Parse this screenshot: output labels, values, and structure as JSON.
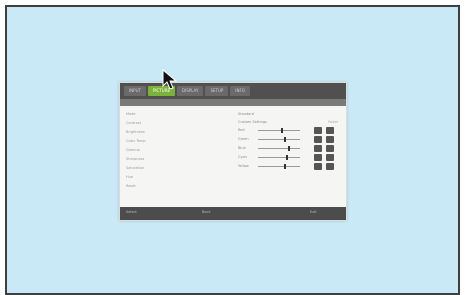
{
  "monitor": {
    "tabs": [
      "INPUT",
      "PICTURE",
      "DISPLAY",
      "SETUP",
      "INFO"
    ],
    "active_tab_index": 1,
    "left_list": [
      "Mode",
      "Contrast",
      "Brightness",
      "Color Temp",
      "Gamma",
      "Sharpness",
      "Saturation",
      "Hue",
      "Reset"
    ],
    "right_panel": {
      "line1": "Standard",
      "line2": "Custom Settings",
      "reset_label": "Reset",
      "rows": [
        {
          "label": "Red",
          "level": 0.55
        },
        {
          "label": "Green",
          "level": 0.62
        },
        {
          "label": "Blue",
          "level": 0.72
        },
        {
          "label": "Cyan",
          "level": 0.66
        },
        {
          "label": "Yellow",
          "level": 0.63
        }
      ]
    },
    "bottom": {
      "left": "Select",
      "middle": "Back",
      "right": "Exit"
    }
  },
  "colors": {
    "background": "#c9e9f6",
    "active_tab": "#7bb33a",
    "frame_border": "#3f3f3f"
  },
  "icons": {
    "cursor": "arrow-cursor-icon"
  }
}
